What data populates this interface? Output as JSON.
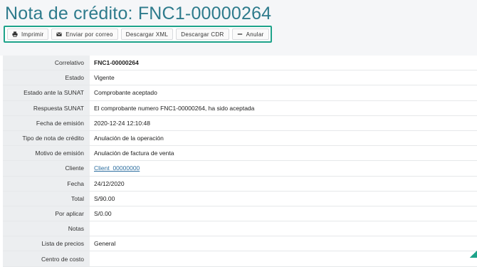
{
  "page": {
    "title": "Nota de crédito: FNC1-00000264"
  },
  "toolbar": {
    "buttons": [
      {
        "label": "Imprimir",
        "icon": "print-icon"
      },
      {
        "label": "Enviar por correo",
        "icon": "envelope-icon"
      },
      {
        "label": "Descargar XML",
        "icon": ""
      },
      {
        "label": "Descargar CDR",
        "icon": ""
      },
      {
        "label": "Anular",
        "icon": "minus-icon"
      }
    ]
  },
  "details": {
    "rows": [
      {
        "label": "Correlativo",
        "value": "FNC1-00000264"
      },
      {
        "label": "Estado",
        "value": "Vigente"
      },
      {
        "label": "Estado ante la SUNAT",
        "value": "Comprobante aceptado"
      },
      {
        "label": "Respuesta SUNAT",
        "value": "El comprobante numero FNC1-00000264, ha sido aceptada"
      },
      {
        "label": "Fecha de emisión",
        "value": "2020-12-24 12:10:48"
      },
      {
        "label": "Tipo de nota de crédito",
        "value": "Anulación de la operación"
      },
      {
        "label": "Motivo de emisión",
        "value": "Anulación de factura de venta"
      },
      {
        "label": "Cliente",
        "value": "Client_00000000"
      },
      {
        "label": "Fecha",
        "value": "24/12/2020"
      },
      {
        "label": "Total",
        "value": "S/90.00"
      },
      {
        "label": "Por aplicar",
        "value": "S/0.00"
      },
      {
        "label": "Notas",
        "value": ""
      },
      {
        "label": "Lista de precios",
        "value": "General"
      },
      {
        "label": "Centro de costo",
        "value": ""
      }
    ]
  },
  "colors": {
    "title": "#2e7b8c",
    "toolbar_border": "#1ea38a",
    "label_bg": "#eceef0",
    "link": "#2e6fa0"
  }
}
